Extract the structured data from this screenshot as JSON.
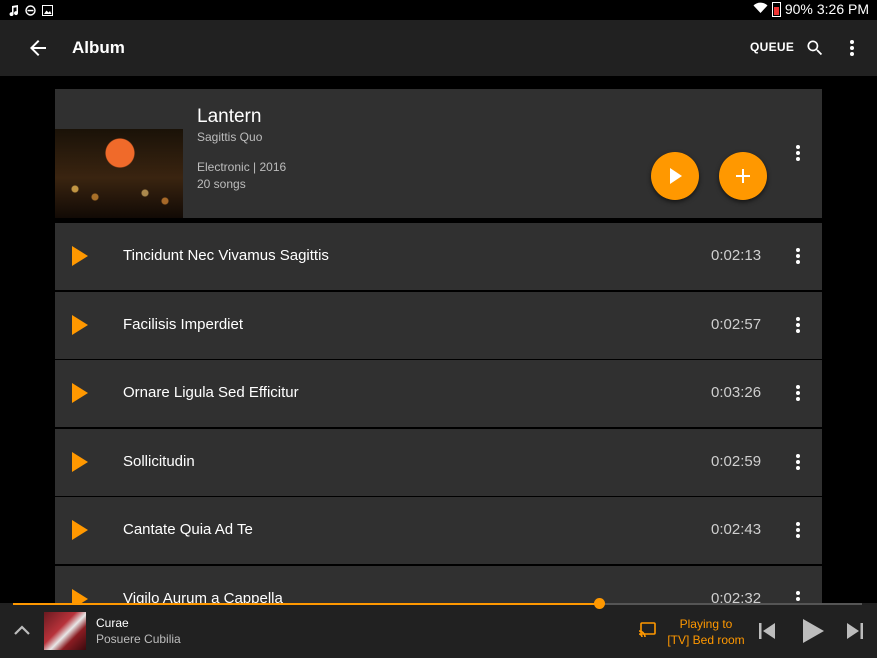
{
  "status_bar": {
    "battery": "90%",
    "time": "3:26 PM"
  },
  "app_bar": {
    "title": "Album",
    "queue_label": "QUEUE"
  },
  "album": {
    "title": "Lantern",
    "artist": "Sagittis Quo",
    "genre_year": "Electronic | 2016",
    "song_count": "20 songs"
  },
  "tracks": [
    {
      "name": "Tincidunt Nec Vivamus Sagittis",
      "duration": "0:02:13"
    },
    {
      "name": "Facilisis Imperdiet",
      "duration": "0:02:57"
    },
    {
      "name": "Ornare Ligula Sed Efficitur",
      "duration": "0:03:26"
    },
    {
      "name": "Sollicitudin",
      "duration": "0:02:59"
    },
    {
      "name": "Cantate Quia Ad Te",
      "duration": "0:02:43"
    },
    {
      "name": "Vigilo Aurum a Cappella",
      "duration": "0:02:32"
    }
  ],
  "now_playing": {
    "title": "Curae",
    "artist": "Posuere Cubilia",
    "cast_line1": "Playing to",
    "cast_line2": "[TV] Bed room",
    "progress": 0.69
  },
  "colors": {
    "accent": "#ff9800",
    "surface": "#303030",
    "bar": "#212121"
  },
  "icons": [
    "back-arrow-icon",
    "search-icon",
    "more-vert-icon",
    "play-icon",
    "add-icon",
    "expand-less-icon",
    "cast-icon",
    "skip-previous-icon",
    "skip-next-icon"
  ]
}
